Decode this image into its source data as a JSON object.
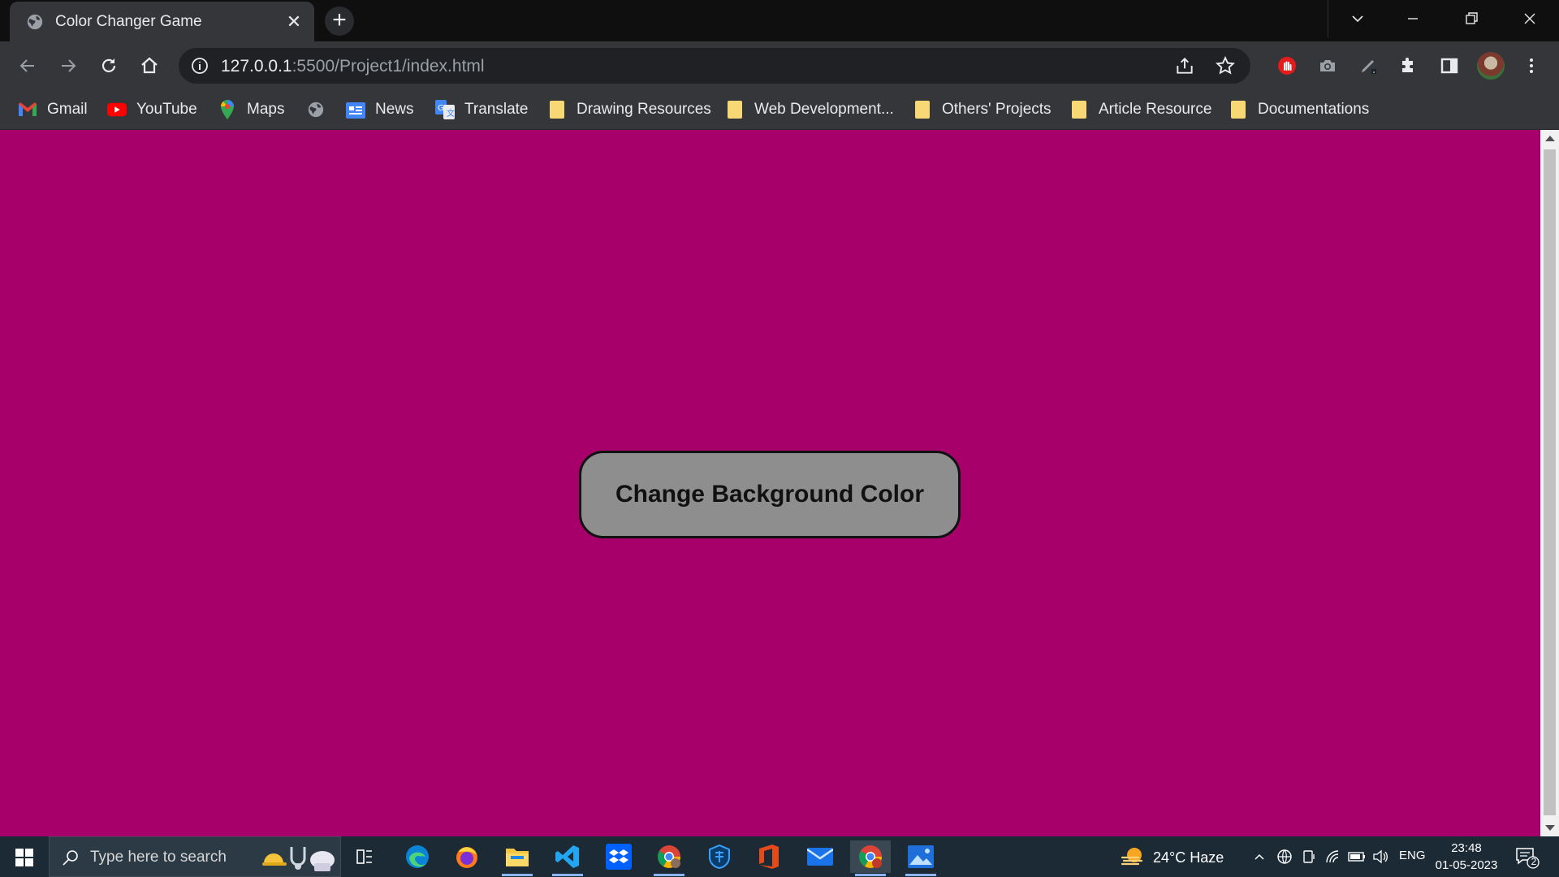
{
  "browser": {
    "tab": {
      "title": "Color Changer Game",
      "close_glyph": "✕"
    },
    "new_tab_glyph": "+",
    "address": {
      "host": "127.0.0.1",
      "rest": ":5500/Project1/index.html"
    }
  },
  "bookmarks": [
    {
      "label": "Gmail",
      "icon": "gmail-icon"
    },
    {
      "label": "YouTube",
      "icon": "youtube-icon"
    },
    {
      "label": "Maps",
      "icon": "maps-icon"
    },
    {
      "label": "",
      "icon": "globe-icon"
    },
    {
      "label": "News",
      "icon": "news-icon"
    },
    {
      "label": "Translate",
      "icon": "translate-icon"
    },
    {
      "label": "Drawing Resources",
      "icon": "folder-icon"
    },
    {
      "label": "Web Development...",
      "icon": "folder-icon"
    },
    {
      "label": "Others' Projects",
      "icon": "folder-icon"
    },
    {
      "label": "Article Resource",
      "icon": "folder-icon"
    },
    {
      "label": "Documentations",
      "icon": "folder-icon"
    }
  ],
  "page": {
    "background_color": "#a8006a",
    "button_label": "Change Background Color",
    "button_color": "#8e8e8e"
  },
  "taskbar": {
    "search_placeholder": "Type here to search",
    "weather": "24°C  Haze",
    "language": "ENG",
    "time": "23:48",
    "date": "01-05-2023",
    "notification_count": "2"
  }
}
